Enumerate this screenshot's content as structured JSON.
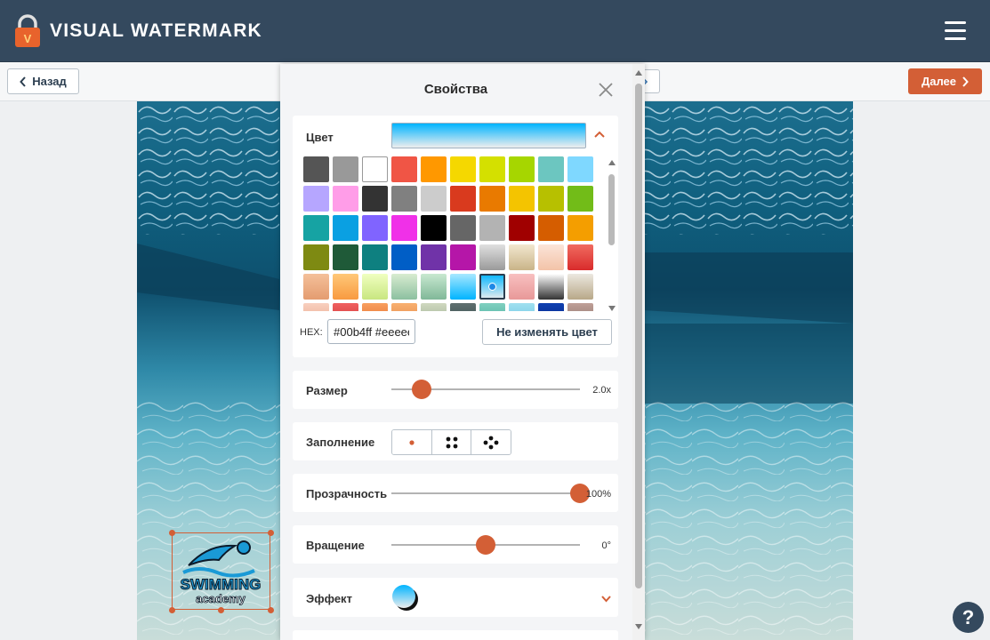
{
  "header": {
    "title": "VISUAL WATERMARK",
    "logo_letter": "V"
  },
  "toolbar": {
    "back_label": "Назад",
    "next_label": "Далее"
  },
  "panel": {
    "title": "Свойства",
    "color": {
      "label": "Цвет",
      "gradient": [
        "#00b4ff",
        "#eeeeee"
      ],
      "hex_label": "HEX:",
      "hex_value": "#00b4ff #eeeeee",
      "keep_color_label": "Не изменять цвет",
      "swatches": [
        [
          "#555555",
          "#999999",
          "#ffffff",
          "#f05545",
          "#ff9800",
          "#f5d800",
          "#d4e000",
          "#a6d600",
          "#6cc6c0",
          "#7fd8ff"
        ],
        [
          "#b6a6ff",
          "#ff9de8",
          "#333333",
          "#808080",
          "#cccccc",
          "#d93a1e",
          "#e97a00",
          "#f4c400",
          "#b7c000",
          "#72bc18"
        ],
        [
          "#16a3a3",
          "#0aa0e2",
          "#8064ff",
          "#f030e8",
          "#000000",
          "#666666",
          "#b3b3b3",
          "#a00000",
          "#d55d00",
          "#f49e00"
        ],
        [
          "#7e8a12",
          "#1f5a38",
          "#0e8080",
          "#005ec6",
          "#7033a8",
          "#b516a8",
          [
            "#e0e0e0",
            "#9a9a9a"
          ],
          [
            "#f2e7cf",
            "#c9b488"
          ],
          [
            "#fbe4d8",
            "#f3c3a8"
          ],
          [
            "#f06b60",
            "#d92b2b"
          ]
        ],
        [
          [
            "#f4c09a",
            "#e49c70"
          ],
          [
            "#ffc878",
            "#f89a40"
          ],
          [
            "#f0ffc0",
            "#c8e680"
          ],
          [
            "#d8ecd0",
            "#8cc0a0"
          ],
          [
            "#c8e8d0",
            "#80b898"
          ],
          [
            "#a8e8ff",
            "#00b4ff"
          ],
          [
            "#00b4ff",
            "#eeeeee"
          ],
          [
            "#f8c0c0",
            "#e89898"
          ],
          [
            "#ffffff",
            "#333333"
          ],
          [
            "#ece8e0",
            "#b8a888"
          ]
        ],
        [
          [
            "#f8d0c0",
            "#e8a080"
          ],
          [
            "#f06060",
            "#c83030"
          ],
          [
            "#f8a060",
            "#e06020"
          ],
          [
            "#f8b070",
            "#e08040"
          ],
          [
            "#d0d8c0",
            "#90a888"
          ],
          [
            "#607070",
            "#304848"
          ],
          [
            "#80d0c0",
            "#40a898"
          ],
          [
            "#a0e0f0",
            "#60c0e0"
          ],
          [
            "#1040b0",
            "#002080"
          ],
          [
            "#c0a098",
            "#806860"
          ]
        ]
      ],
      "selected": [
        4,
        6
      ]
    },
    "size": {
      "label": "Размер",
      "value": "2.0x",
      "level": 0.16
    },
    "fill": {
      "label": "Заполнение"
    },
    "opacity": {
      "label": "Прозрачность",
      "value": "100%",
      "level": 1.0
    },
    "rotation": {
      "label": "Вращение",
      "value": "0°",
      "level": 0.5
    },
    "effect": {
      "label": "Эффект"
    }
  },
  "watermark": {
    "line1": "SWIMMING",
    "line2": "academy"
  },
  "help": {
    "label": "?"
  }
}
